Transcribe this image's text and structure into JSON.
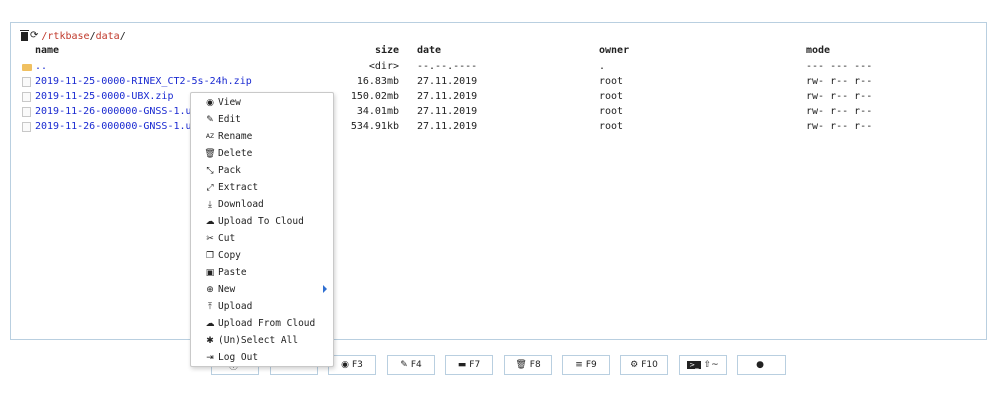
{
  "path": {
    "root": "/rtkbase",
    "segment": "data",
    "sep": "/",
    "trail": "/"
  },
  "columns": {
    "name": "name",
    "size": "size",
    "date": "date",
    "owner": "owner",
    "mode": "mode"
  },
  "rows": [
    {
      "name": "..",
      "size": "<dir>",
      "date": "--.--.----",
      "owner": ".",
      "mode": "--- --- ---",
      "type": "folder"
    },
    {
      "name": "2019-11-25-0000-RINEX_CT2-5s-24h.zip",
      "size": "16.83mb",
      "date": "27.11.2019",
      "owner": "root",
      "mode": "rw- r-- r--",
      "type": "file"
    },
    {
      "name": "2019-11-25-0000-UBX.zip",
      "size": "150.02mb",
      "date": "27.11.2019",
      "owner": "root",
      "mode": "rw- r-- r--",
      "type": "file"
    },
    {
      "name": "2019-11-26-000000-GNSS-1.u",
      "size": "34.01mb",
      "date": "27.11.2019",
      "owner": "root",
      "mode": "rw- r-- r--",
      "type": "file"
    },
    {
      "name": "2019-11-26-000000-GNSS-1.u",
      "size": "534.91kb",
      "date": "27.11.2019",
      "owner": "root",
      "mode": "rw- r-- r--",
      "type": "file"
    }
  ],
  "context_menu": [
    {
      "label": "View",
      "icon": "eye-icon"
    },
    {
      "label": "Edit",
      "icon": "edit-icon"
    },
    {
      "label": "Rename",
      "icon": "sort-alpha-icon"
    },
    {
      "label": "Delete",
      "icon": "trash-icon"
    },
    {
      "label": "Pack",
      "icon": "compress-icon"
    },
    {
      "label": "Extract",
      "icon": "expand-icon"
    },
    {
      "label": "Download",
      "icon": "download-icon"
    },
    {
      "label": "Upload To Cloud",
      "icon": "cloud-upload-icon"
    },
    {
      "label": "Cut",
      "icon": "scissors-icon"
    },
    {
      "label": "Copy",
      "icon": "copy-icon"
    },
    {
      "label": "Paste",
      "icon": "paste-icon"
    },
    {
      "label": "New",
      "icon": "new-file-icon",
      "submenu": true
    },
    {
      "label": "Upload",
      "icon": "upload-icon"
    },
    {
      "label": "Upload From Cloud",
      "icon": "cloud-download-icon"
    },
    {
      "label": "(Un)Select All",
      "icon": "asterisk-icon"
    },
    {
      "label": "Log Out",
      "icon": "logout-icon"
    }
  ],
  "toolbar": [
    {
      "label": "",
      "icon": "info-icon"
    },
    {
      "label": "",
      "icon": "list-icon"
    },
    {
      "label": "F3",
      "icon": "eye-icon"
    },
    {
      "label": "F4",
      "icon": "edit-icon"
    },
    {
      "label": "F7",
      "icon": "folder-icon"
    },
    {
      "label": "F8",
      "icon": "trash-icon"
    },
    {
      "label": "F9",
      "icon": "menu-icon"
    },
    {
      "label": "F10",
      "icon": "gear-icon"
    },
    {
      "label": "⇧~",
      "icon": "terminal-icon"
    },
    {
      "label": "",
      "icon": "chat-icon"
    }
  ],
  "colors": {
    "link": "#1a2ad1",
    "path": "#c0392b",
    "border": "#b9cfe0",
    "folder": "#f0c060"
  }
}
